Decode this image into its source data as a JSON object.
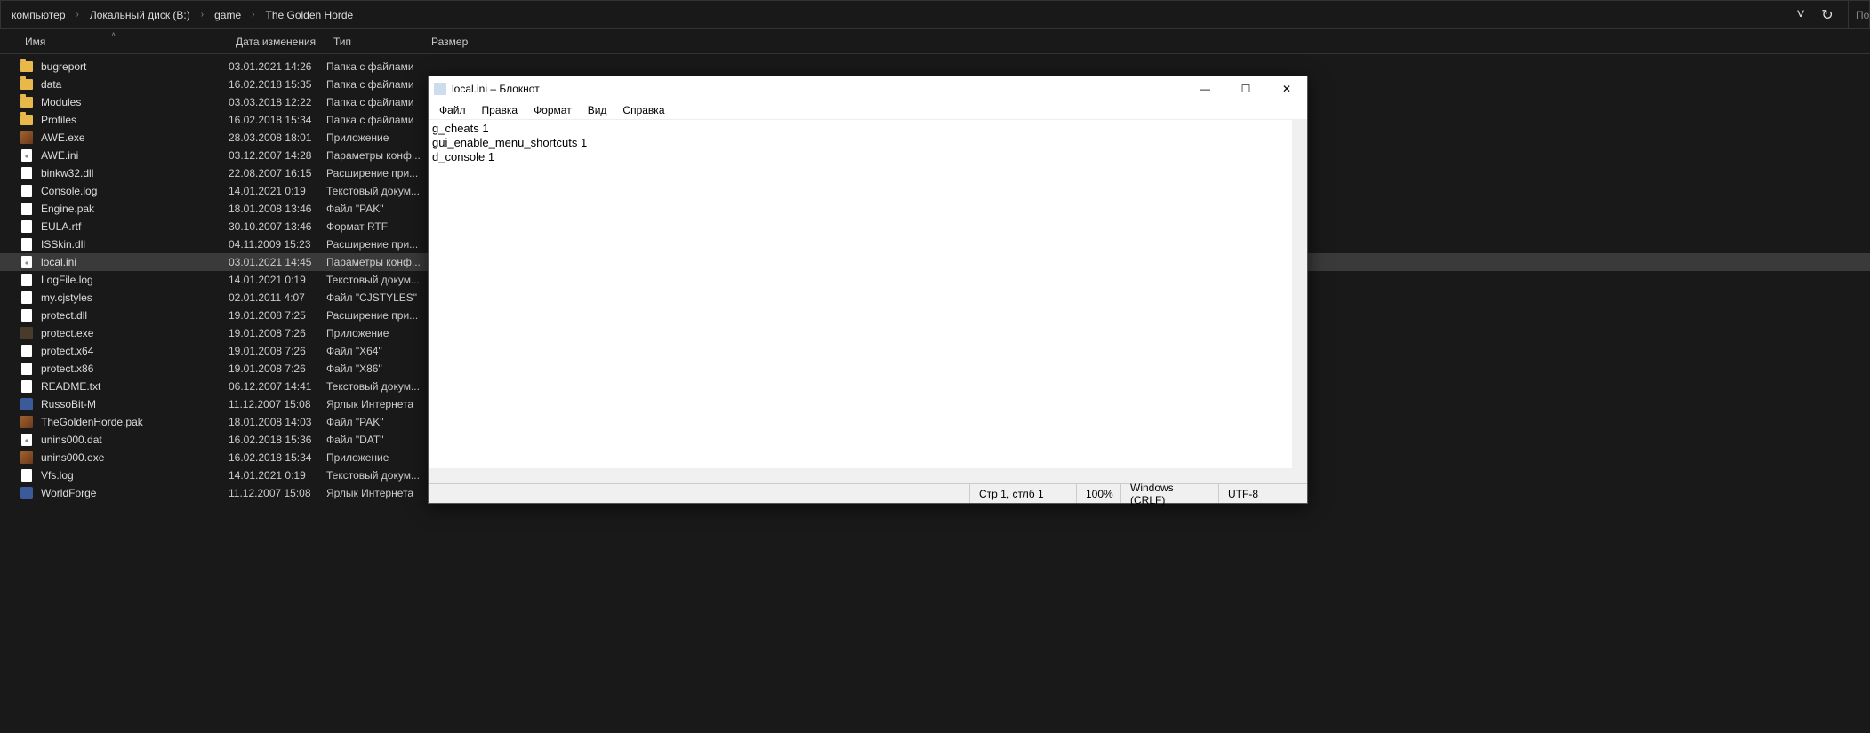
{
  "breadcrumb": [
    "компьютер",
    "Локальный диск (B:)",
    "game",
    "The Golden Horde"
  ],
  "breadcrumb_sep": "›",
  "search_placeholder": "По",
  "columns": {
    "name": "Имя",
    "date": "Дата изменения",
    "type": "Тип",
    "size": "Размер"
  },
  "files": [
    {
      "icon": "folder",
      "name": "bugreport",
      "date": "03.01.2021 14:26",
      "type": "Папка с файлами",
      "selected": false
    },
    {
      "icon": "folder",
      "name": "data",
      "date": "16.02.2018 15:35",
      "type": "Папка с файлами",
      "selected": false
    },
    {
      "icon": "folder",
      "name": "Modules",
      "date": "03.03.2018 12:22",
      "type": "Папка с файлами",
      "selected": false
    },
    {
      "icon": "folder",
      "name": "Profiles",
      "date": "16.02.2018 15:34",
      "type": "Папка с файлами",
      "selected": false
    },
    {
      "icon": "app",
      "name": "AWE.exe",
      "date": "28.03.2008 18:01",
      "type": "Приложение",
      "selected": false
    },
    {
      "icon": "ini",
      "name": "AWE.ini",
      "date": "03.12.2007 14:28",
      "type": "Параметры конф...",
      "selected": false
    },
    {
      "icon": "file",
      "name": "binkw32.dll",
      "date": "22.08.2007 16:15",
      "type": "Расширение при...",
      "selected": false
    },
    {
      "icon": "file",
      "name": "Console.log",
      "date": "14.01.2021 0:19",
      "type": "Текстовый докум...",
      "selected": false
    },
    {
      "icon": "file",
      "name": "Engine.pak",
      "date": "18.01.2008 13:46",
      "type": "Файл \"PAK\"",
      "selected": false
    },
    {
      "icon": "file",
      "name": "EULA.rtf",
      "date": "30.10.2007 13:46",
      "type": "Формат RTF",
      "selected": false
    },
    {
      "icon": "file",
      "name": "ISSkin.dll",
      "date": "04.11.2009 15:23",
      "type": "Расширение при...",
      "selected": false
    },
    {
      "icon": "ini",
      "name": "local.ini",
      "date": "03.01.2021 14:45",
      "type": "Параметры конф...",
      "selected": true
    },
    {
      "icon": "file",
      "name": "LogFile.log",
      "date": "14.01.2021 0:19",
      "type": "Текстовый докум...",
      "selected": false
    },
    {
      "icon": "file",
      "name": "my.cjstyles",
      "date": "02.01.2011 4:07",
      "type": "Файл \"CJSTYLES\"",
      "selected": false
    },
    {
      "icon": "file",
      "name": "protect.dll",
      "date": "19.01.2008 7:25",
      "type": "Расширение при...",
      "selected": false
    },
    {
      "icon": "exe",
      "name": "protect.exe",
      "date": "19.01.2008 7:26",
      "type": "Приложение",
      "selected": false
    },
    {
      "icon": "file",
      "name": "protect.x64",
      "date": "19.01.2008 7:26",
      "type": "Файл \"X64\"",
      "selected": false
    },
    {
      "icon": "file",
      "name": "protect.x86",
      "date": "19.01.2008 7:26",
      "type": "Файл \"X86\"",
      "selected": false
    },
    {
      "icon": "file",
      "name": "README.txt",
      "date": "06.12.2007 14:41",
      "type": "Текстовый докум...",
      "selected": false
    },
    {
      "icon": "link",
      "name": "RussoBit-M",
      "date": "11.12.2007 15:08",
      "type": "Ярлык Интернета",
      "selected": false
    },
    {
      "icon": "app",
      "name": "TheGoldenHorde.pak",
      "date": "18.01.2008 14:03",
      "type": "Файл \"PAK\"",
      "selected": false
    },
    {
      "icon": "ini",
      "name": "unins000.dat",
      "date": "16.02.2018 15:36",
      "type": "Файл \"DAT\"",
      "selected": false
    },
    {
      "icon": "app",
      "name": "unins000.exe",
      "date": "16.02.2018 15:34",
      "type": "Приложение",
      "selected": false
    },
    {
      "icon": "file",
      "name": "Vfs.log",
      "date": "14.01.2021 0:19",
      "type": "Текстовый докум...",
      "selected": false
    },
    {
      "icon": "link",
      "name": "WorldForge",
      "date": "11.12.2007 15:08",
      "type": "Ярлык Интернета",
      "selected": false
    }
  ],
  "notepad": {
    "title": "local.ini – Блокнот",
    "menus": [
      "Файл",
      "Правка",
      "Формат",
      "Вид",
      "Справка"
    ],
    "content": "g_cheats 1\ngui_enable_menu_shortcuts 1\nd_console 1",
    "status": {
      "pos": "Стр 1, стлб 1",
      "zoom": "100%",
      "eol": "Windows (CRLF)",
      "enc": "UTF-8"
    }
  }
}
